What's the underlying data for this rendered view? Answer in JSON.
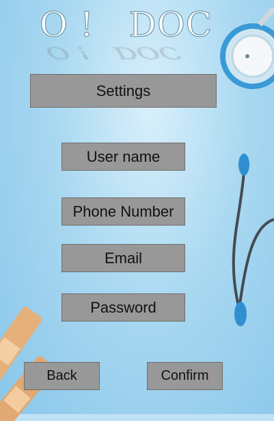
{
  "app": {
    "logo_text": "O !   DOC"
  },
  "header": {
    "title": "Settings"
  },
  "fields": {
    "username_label": "User name",
    "phone_label": "Phone Number",
    "email_label": "Email",
    "password_label": "Password"
  },
  "footer": {
    "back_label": "Back",
    "confirm_label": "Confirm"
  },
  "icons": {
    "stethoscope": "stethoscope-icon",
    "bandage": "bandage-icon"
  },
  "colors": {
    "background": "#a9d8f1",
    "button": "#989898"
  }
}
